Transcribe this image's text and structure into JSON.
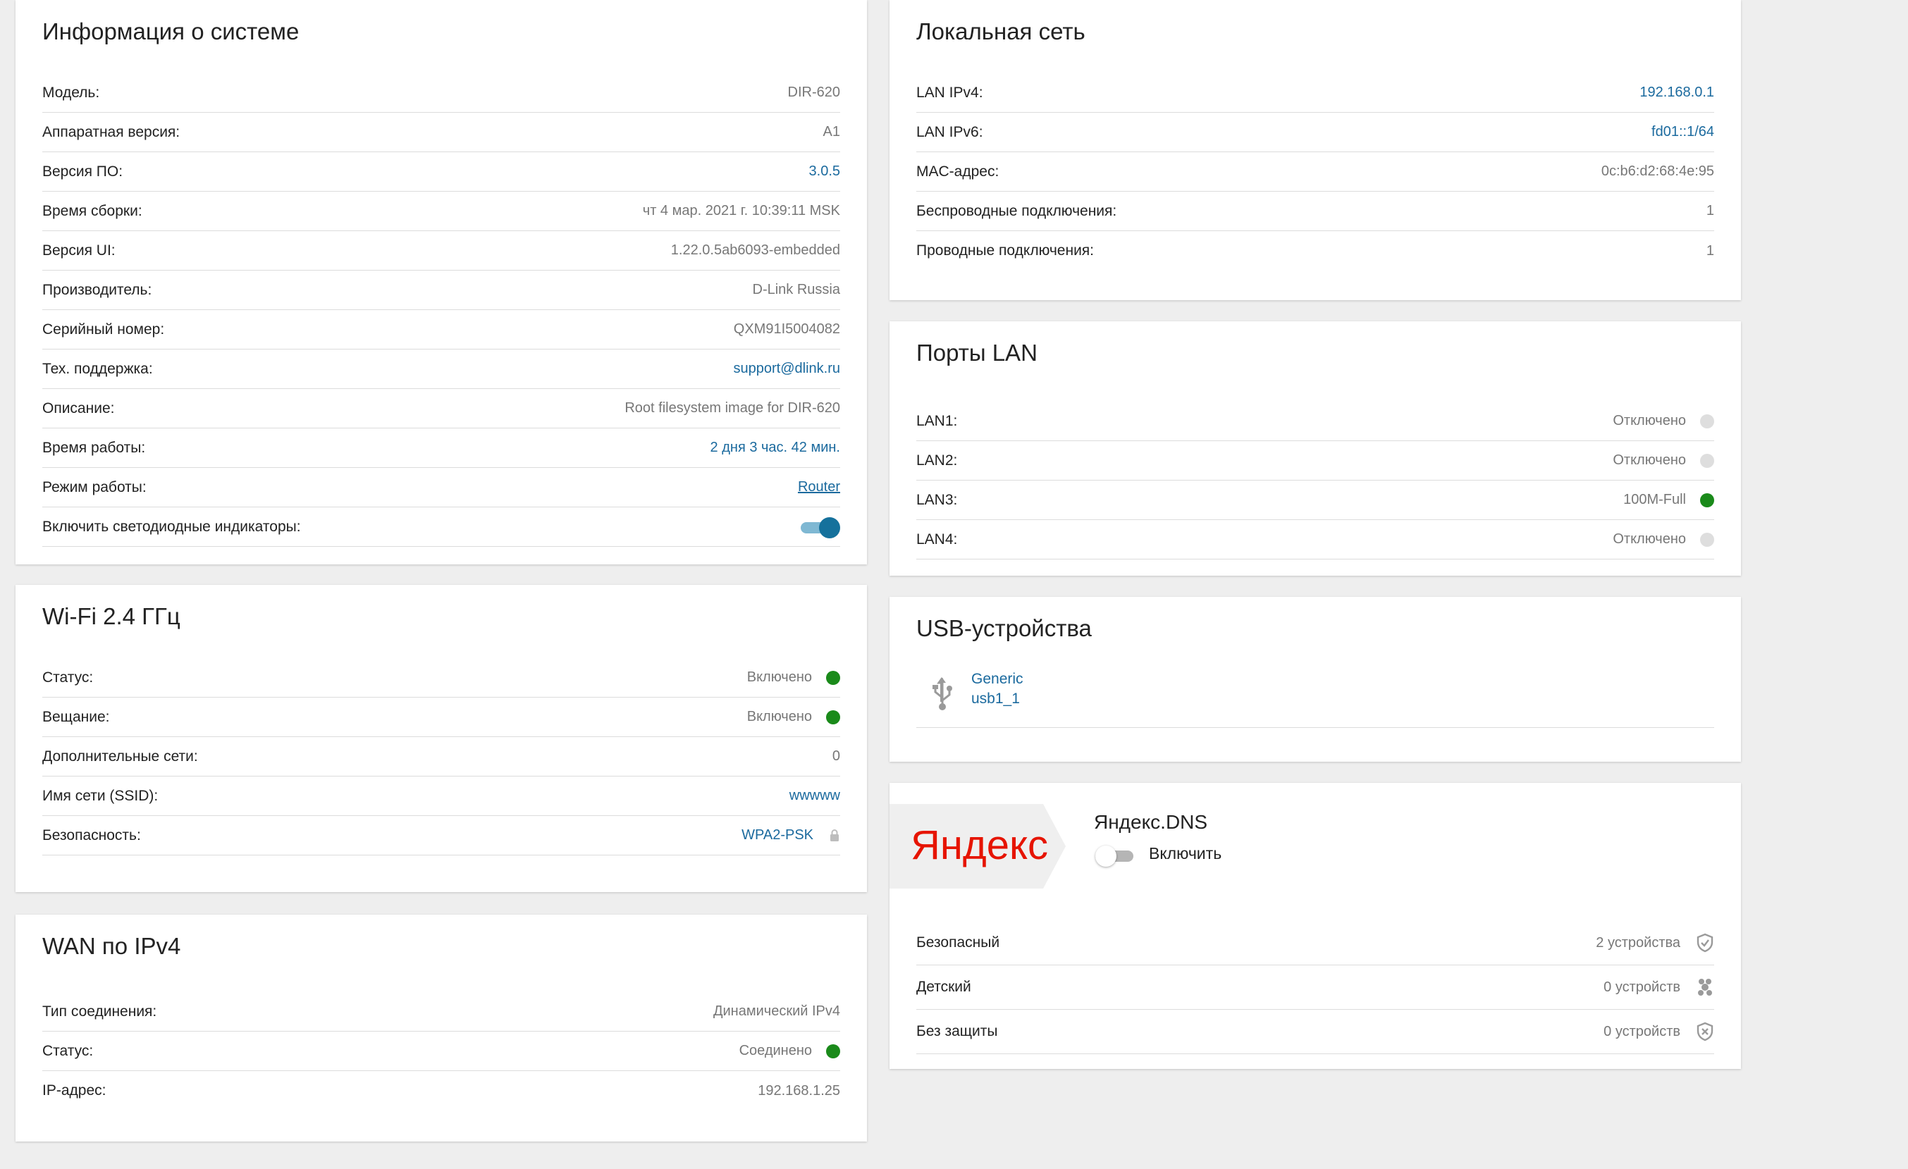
{
  "system": {
    "title": "Информация о системе",
    "rows": [
      {
        "label": "Модель:",
        "value": "DIR-620"
      },
      {
        "label": "Аппаратная версия:",
        "value": "A1"
      },
      {
        "label": "Версия ПО:",
        "value": "3.0.5"
      },
      {
        "label": "Время сборки:",
        "value": "чт 4 мар. 2021 г. 10:39:11 MSK"
      },
      {
        "label": "Версия UI:",
        "value": "1.22.0.5ab6093-embedded"
      },
      {
        "label": "Производитель:",
        "value": "D-Link Russia"
      },
      {
        "label": "Серийный номер:",
        "value": "QXM91I5004082"
      },
      {
        "label": "Тех. поддержка:",
        "value": "support@dlink.ru"
      },
      {
        "label": "Описание:",
        "value": "Root filesystem image for DIR-620"
      },
      {
        "label": "Время работы:",
        "value": "2 дня 3 час. 42 мин."
      },
      {
        "label": "Режим работы:",
        "value": "Router"
      },
      {
        "label": "Включить светодиодные индикаторы:",
        "value": ""
      }
    ]
  },
  "wifi": {
    "title": "Wi-Fi 2.4 ГГц",
    "rows": [
      {
        "label": "Статус:",
        "value": "Включено"
      },
      {
        "label": "Вещание:",
        "value": "Включено"
      },
      {
        "label": "Дополнительные сети:",
        "value": "0"
      },
      {
        "label": "Имя сети (SSID):",
        "value": "wwwww"
      },
      {
        "label": "Безопасность:",
        "value": "WPA2-PSK"
      }
    ]
  },
  "wan": {
    "title": "WAN по IPv4",
    "rows": [
      {
        "label": "Тип соединения:",
        "value": "Динамический IPv4"
      },
      {
        "label": "Статус:",
        "value": "Соединено"
      },
      {
        "label": "IP-адрес:",
        "value": "192.168.1.25"
      }
    ]
  },
  "lan": {
    "title": "Локальная сеть",
    "rows": [
      {
        "label": "LAN IPv4:",
        "value": "192.168.0.1"
      },
      {
        "label": "LAN IPv6:",
        "value": "fd01::1/64"
      },
      {
        "label": "MAC-адрес:",
        "value": "0c:b6:d2:68:4e:95"
      },
      {
        "label": "Беспроводные подключения:",
        "value": "1"
      },
      {
        "label": "Проводные подключения:",
        "value": "1"
      }
    ]
  },
  "ports": {
    "title": "Порты LAN",
    "rows": [
      {
        "label": "LAN1:",
        "value": "Отключено"
      },
      {
        "label": "LAN2:",
        "value": "Отключено"
      },
      {
        "label": "LAN3:",
        "value": "100M-Full"
      },
      {
        "label": "LAN4:",
        "value": "Отключено"
      }
    ]
  },
  "usb": {
    "title": "USB-устройства",
    "device_name": "Generic",
    "device_id": "usb1_1"
  },
  "yandex": {
    "logo_text": "Яндекс",
    "title": "Яндекс.DNS",
    "toggle_label": "Включить",
    "rows": [
      {
        "label": "Безопасный",
        "value": "2 устройства"
      },
      {
        "label": "Детский",
        "value": "0 устройств"
      },
      {
        "label": "Без защиты",
        "value": "0 устройств"
      }
    ]
  },
  "colors": {
    "background": "#eeeeee",
    "link": "#1b6a9e",
    "status_on": "#1a8a1a",
    "status_off": "#dedede",
    "toggle_on": "#15719c",
    "yandex_red": "#e61400"
  }
}
